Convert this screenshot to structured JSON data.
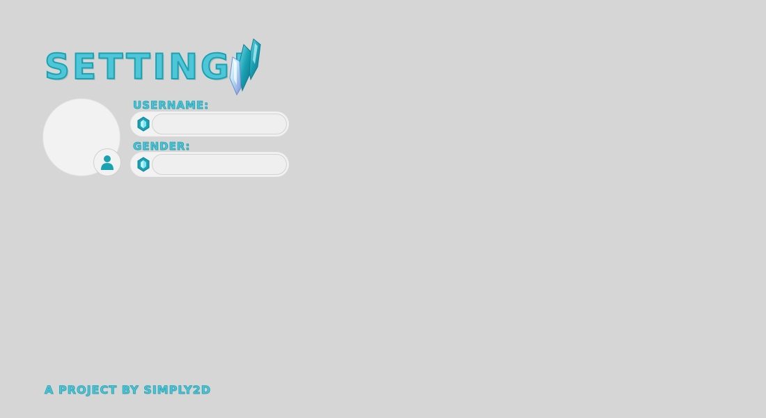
{
  "header": {
    "title": "SETTING!",
    "crystal_icon": "crystal-cluster-icon"
  },
  "profile": {
    "avatar_icon": "user-icon"
  },
  "form": {
    "username": {
      "label": "USERNAME:",
      "value": "",
      "icon": "gem-icon"
    },
    "gender": {
      "label": "GENDER:",
      "value": "",
      "icon": "gem-icon"
    }
  },
  "footer": {
    "credit": "A PROJECT BY SIMPLY2D"
  },
  "colors": {
    "background": "#d6d6d6",
    "accent": "#4fc6d8",
    "accent_dark": "#1aa2b3",
    "panel": "#f2f2f2"
  }
}
